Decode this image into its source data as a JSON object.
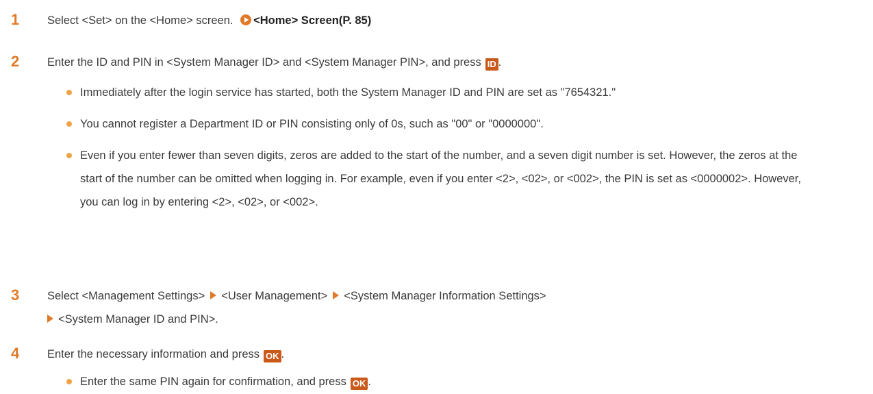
{
  "steps": [
    {
      "number": "1",
      "text": "Select <Set> on the <Home> screen.",
      "link_text": "<Home> Screen(P. 85)"
    },
    {
      "number": "2",
      "text": "Enter the ID and PIN in <System Manager ID> and <System Manager PIN>, and press",
      "key_label": "ID",
      "text_end": ".",
      "bullets": [
        "Immediately after the login service has started, both the System Manager ID and PIN are set as \"7654321.\"",
        "You cannot register a Department ID or PIN consisting only of 0s, such as \"00\" or \"0000000\".",
        "Even if you enter fewer than seven digits, zeros are added to the start of the number, and a seven digit number is set. However, the zeros at the start of the number can be omitted when logging in. For example, even if you enter <2>, <02>, or <002>, the PIN is set as <0000002>. However, you can log in by entering <2>, <02>, or <002>."
      ]
    },
    {
      "number": "3",
      "parts": [
        "Select <Management Settings>",
        "<User Management>",
        "<System Manager Information Settings>",
        "<System Manager ID and PIN>."
      ]
    },
    {
      "number": "4",
      "text": "Enter the necessary information and press",
      "key_label": "OK",
      "text_end": ".",
      "bullets": [
        "Enter the same PIN again for confirmation, and press"
      ],
      "bullet_key_label": "OK",
      "bullet_end": "."
    }
  ],
  "colors": {
    "step_number": "#e07a28",
    "key_bg": "#c95a1a",
    "bullet": "#f0a448"
  }
}
